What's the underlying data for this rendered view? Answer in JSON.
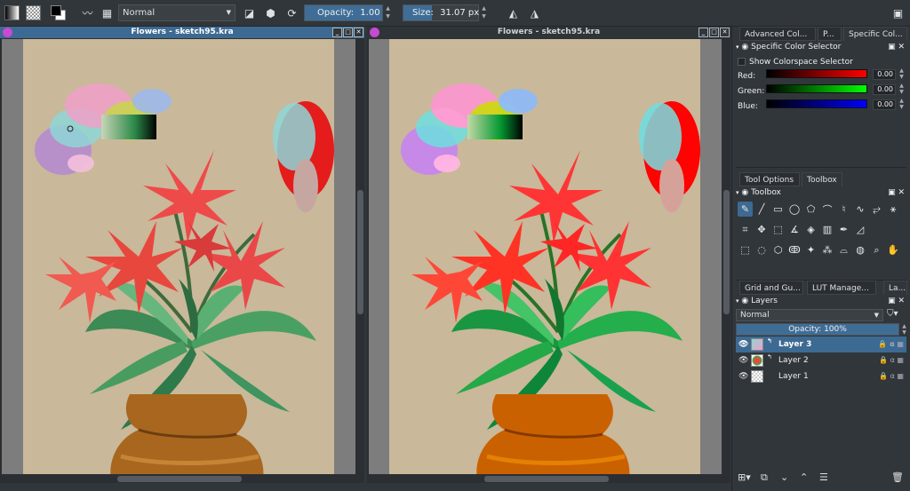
{
  "toolbar": {
    "blend_mode": "Normal",
    "opacity_label": "Opacity:",
    "opacity_value": "1.00",
    "opacity_fraction": 1.0,
    "size_label": "Size:",
    "size_value": "31.07 px",
    "size_fraction": 0.38
  },
  "windows": [
    {
      "title": "Flowers - sketch95.kra",
      "active": true
    },
    {
      "title": "Flowers - sketch95.kra",
      "active": false
    }
  ],
  "dock": {
    "top_tabs": [
      "Advanced Col...",
      "P...",
      "Specific Col..."
    ],
    "specific_color": {
      "title": "Specific Color Selector",
      "show_colorspace": "Show Colorspace Selector",
      "channels": [
        {
          "label": "Red:",
          "value": "0.00",
          "color": "#ff0000"
        },
        {
          "label": "Green:",
          "value": "0.00",
          "color": "#00ff00"
        },
        {
          "label": "Blue:",
          "value": "0.00",
          "color": "#0000ff"
        }
      ]
    },
    "mid_tabs": [
      "Tool Options",
      "Toolbox"
    ],
    "toolbox_title": "Toolbox",
    "tools": [
      [
        "freehand-brush",
        "line",
        "rectangle",
        "ellipse",
        "polygon",
        "polyline",
        "bezier",
        "freehand-path",
        "dynamic-brush",
        "multibrush"
      ],
      [
        "crop",
        "move",
        "transform",
        "measure-angle",
        "fill",
        "gradient",
        "color-picker",
        "assistant"
      ],
      [
        "rect-select",
        "ellipse-select",
        "polygon-select",
        "freehand-select",
        "magic-wand",
        "similar-select",
        "bezier-select",
        "path-select",
        "zoom",
        "pan"
      ]
    ],
    "bottom_tabs": [
      "Grid and Gu...",
      "LUT Manage...",
      "La..."
    ],
    "layers": {
      "title": "Layers",
      "blend_mode": "Normal",
      "opacity_label": "Opacity:",
      "opacity_value": "100%",
      "items": [
        {
          "name": "Layer 3",
          "selected": true
        },
        {
          "name": "Layer 2",
          "selected": false
        },
        {
          "name": "Layer 1",
          "selected": false
        }
      ]
    }
  },
  "colors": {
    "accent": "#3d6a92",
    "canvas": "#c9b89a",
    "panel": "#31363b"
  }
}
